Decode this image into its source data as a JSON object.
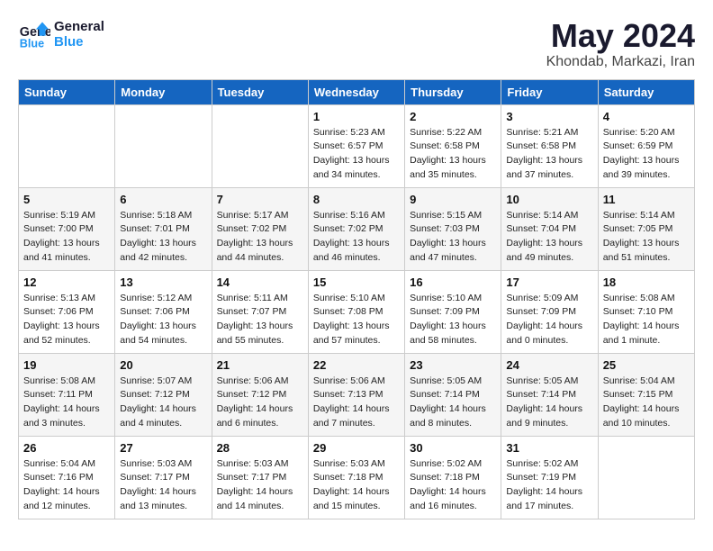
{
  "header": {
    "logo_line1": "General",
    "logo_line2": "Blue",
    "month": "May 2024",
    "location": "Khondab, Markazi, Iran"
  },
  "days_of_week": [
    "Sunday",
    "Monday",
    "Tuesday",
    "Wednesday",
    "Thursday",
    "Friday",
    "Saturday"
  ],
  "weeks": [
    [
      {
        "day": "",
        "info": ""
      },
      {
        "day": "",
        "info": ""
      },
      {
        "day": "",
        "info": ""
      },
      {
        "day": "1",
        "info": "Sunrise: 5:23 AM\nSunset: 6:57 PM\nDaylight: 13 hours\nand 34 minutes."
      },
      {
        "day": "2",
        "info": "Sunrise: 5:22 AM\nSunset: 6:58 PM\nDaylight: 13 hours\nand 35 minutes."
      },
      {
        "day": "3",
        "info": "Sunrise: 5:21 AM\nSunset: 6:58 PM\nDaylight: 13 hours\nand 37 minutes."
      },
      {
        "day": "4",
        "info": "Sunrise: 5:20 AM\nSunset: 6:59 PM\nDaylight: 13 hours\nand 39 minutes."
      }
    ],
    [
      {
        "day": "5",
        "info": "Sunrise: 5:19 AM\nSunset: 7:00 PM\nDaylight: 13 hours\nand 41 minutes."
      },
      {
        "day": "6",
        "info": "Sunrise: 5:18 AM\nSunset: 7:01 PM\nDaylight: 13 hours\nand 42 minutes."
      },
      {
        "day": "7",
        "info": "Sunrise: 5:17 AM\nSunset: 7:02 PM\nDaylight: 13 hours\nand 44 minutes."
      },
      {
        "day": "8",
        "info": "Sunrise: 5:16 AM\nSunset: 7:02 PM\nDaylight: 13 hours\nand 46 minutes."
      },
      {
        "day": "9",
        "info": "Sunrise: 5:15 AM\nSunset: 7:03 PM\nDaylight: 13 hours\nand 47 minutes."
      },
      {
        "day": "10",
        "info": "Sunrise: 5:14 AM\nSunset: 7:04 PM\nDaylight: 13 hours\nand 49 minutes."
      },
      {
        "day": "11",
        "info": "Sunrise: 5:14 AM\nSunset: 7:05 PM\nDaylight: 13 hours\nand 51 minutes."
      }
    ],
    [
      {
        "day": "12",
        "info": "Sunrise: 5:13 AM\nSunset: 7:06 PM\nDaylight: 13 hours\nand 52 minutes."
      },
      {
        "day": "13",
        "info": "Sunrise: 5:12 AM\nSunset: 7:06 PM\nDaylight: 13 hours\nand 54 minutes."
      },
      {
        "day": "14",
        "info": "Sunrise: 5:11 AM\nSunset: 7:07 PM\nDaylight: 13 hours\nand 55 minutes."
      },
      {
        "day": "15",
        "info": "Sunrise: 5:10 AM\nSunset: 7:08 PM\nDaylight: 13 hours\nand 57 minutes."
      },
      {
        "day": "16",
        "info": "Sunrise: 5:10 AM\nSunset: 7:09 PM\nDaylight: 13 hours\nand 58 minutes."
      },
      {
        "day": "17",
        "info": "Sunrise: 5:09 AM\nSunset: 7:09 PM\nDaylight: 14 hours\nand 0 minutes."
      },
      {
        "day": "18",
        "info": "Sunrise: 5:08 AM\nSunset: 7:10 PM\nDaylight: 14 hours\nand 1 minute."
      }
    ],
    [
      {
        "day": "19",
        "info": "Sunrise: 5:08 AM\nSunset: 7:11 PM\nDaylight: 14 hours\nand 3 minutes."
      },
      {
        "day": "20",
        "info": "Sunrise: 5:07 AM\nSunset: 7:12 PM\nDaylight: 14 hours\nand 4 minutes."
      },
      {
        "day": "21",
        "info": "Sunrise: 5:06 AM\nSunset: 7:12 PM\nDaylight: 14 hours\nand 6 minutes."
      },
      {
        "day": "22",
        "info": "Sunrise: 5:06 AM\nSunset: 7:13 PM\nDaylight: 14 hours\nand 7 minutes."
      },
      {
        "day": "23",
        "info": "Sunrise: 5:05 AM\nSunset: 7:14 PM\nDaylight: 14 hours\nand 8 minutes."
      },
      {
        "day": "24",
        "info": "Sunrise: 5:05 AM\nSunset: 7:14 PM\nDaylight: 14 hours\nand 9 minutes."
      },
      {
        "day": "25",
        "info": "Sunrise: 5:04 AM\nSunset: 7:15 PM\nDaylight: 14 hours\nand 10 minutes."
      }
    ],
    [
      {
        "day": "26",
        "info": "Sunrise: 5:04 AM\nSunset: 7:16 PM\nDaylight: 14 hours\nand 12 minutes."
      },
      {
        "day": "27",
        "info": "Sunrise: 5:03 AM\nSunset: 7:17 PM\nDaylight: 14 hours\nand 13 minutes."
      },
      {
        "day": "28",
        "info": "Sunrise: 5:03 AM\nSunset: 7:17 PM\nDaylight: 14 hours\nand 14 minutes."
      },
      {
        "day": "29",
        "info": "Sunrise: 5:03 AM\nSunset: 7:18 PM\nDaylight: 14 hours\nand 15 minutes."
      },
      {
        "day": "30",
        "info": "Sunrise: 5:02 AM\nSunset: 7:18 PM\nDaylight: 14 hours\nand 16 minutes."
      },
      {
        "day": "31",
        "info": "Sunrise: 5:02 AM\nSunset: 7:19 PM\nDaylight: 14 hours\nand 17 minutes."
      },
      {
        "day": "",
        "info": ""
      }
    ]
  ]
}
